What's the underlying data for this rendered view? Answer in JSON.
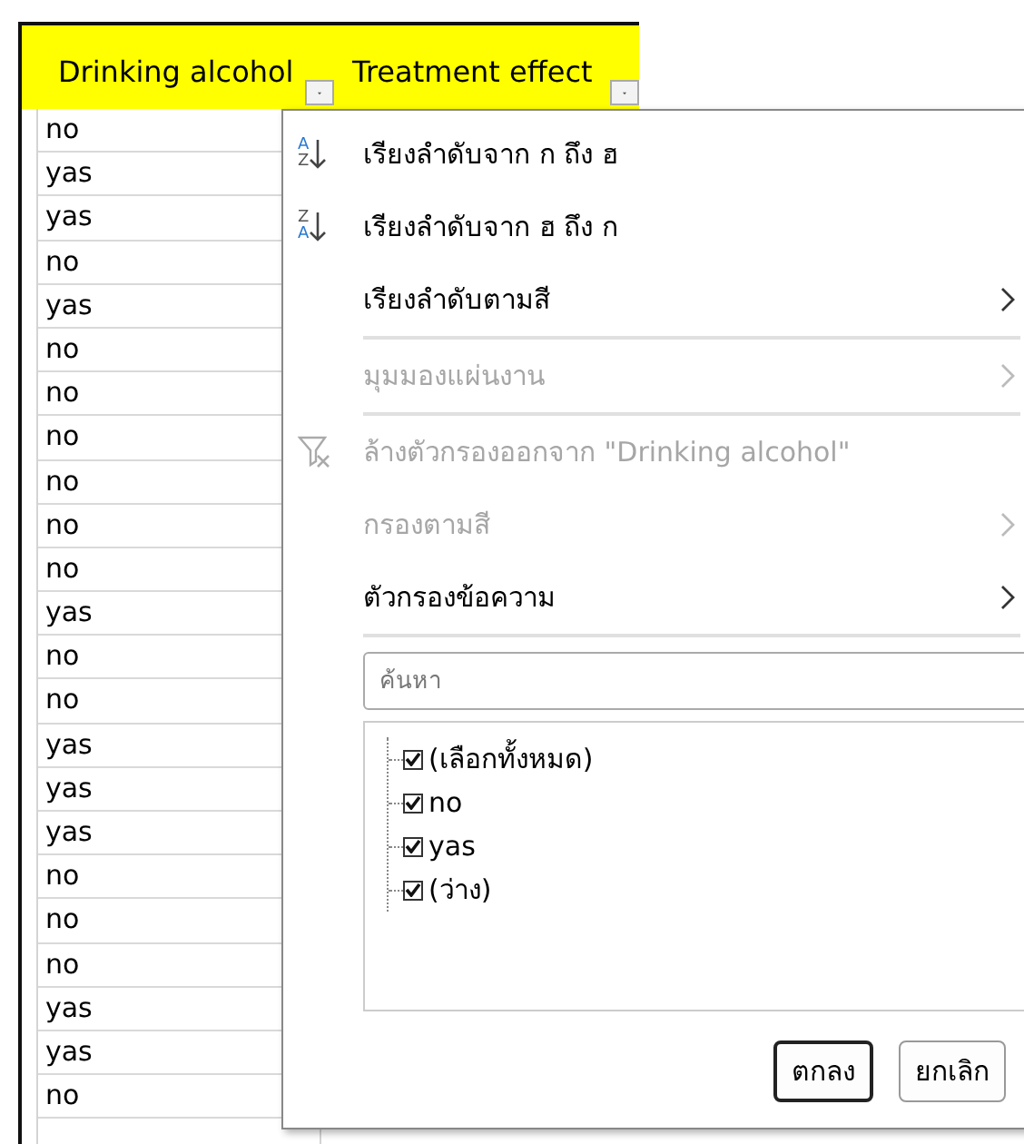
{
  "sheet": {
    "columns": [
      {
        "header": "Drinking alcohol"
      },
      {
        "header": "Treatment effect"
      }
    ],
    "column_b_values": [
      "no",
      "yas",
      "yas",
      "no",
      "yas",
      "no",
      "no",
      "no",
      "no",
      "no",
      "no",
      "yas",
      "no",
      "no",
      "yas",
      "yas",
      "yas",
      "no",
      "no",
      "no",
      "yas",
      "yas",
      "no"
    ]
  },
  "filter_menu": {
    "items": [
      {
        "kind": "sort",
        "icon_letters": [
          "A",
          "Z"
        ],
        "label": "เรียงลำดับจาก ก ถึง ฮ",
        "disabled": false,
        "submenu": false
      },
      {
        "kind": "sort",
        "icon_letters": [
          "Z",
          "A"
        ],
        "label": "เรียงลำดับจาก ฮ ถึง ก",
        "disabled": false,
        "submenu": false
      },
      {
        "kind": "item",
        "label": "เรียงลำดับตามสี",
        "disabled": false,
        "submenu": true
      },
      {
        "kind": "separator"
      },
      {
        "kind": "item",
        "label": "มุมมองแผ่นงาน",
        "disabled": true,
        "submenu": true
      },
      {
        "kind": "separator"
      },
      {
        "kind": "clear",
        "label": "ล้างตัวกรองออกจาก \"Drinking alcohol\"",
        "disabled": true,
        "submenu": false
      },
      {
        "kind": "item",
        "label": "กรองตามสี",
        "disabled": true,
        "submenu": true
      },
      {
        "kind": "item",
        "label": "ตัวกรองข้อความ",
        "disabled": false,
        "submenu": true
      },
      {
        "kind": "separator"
      }
    ],
    "search": {
      "placeholder": "ค้นหา"
    },
    "values": [
      {
        "label": "(เลือกทั้งหมด)",
        "checked": true
      },
      {
        "label": "no",
        "checked": true
      },
      {
        "label": "yas",
        "checked": true
      },
      {
        "label": "(ว่าง)",
        "checked": true
      }
    ],
    "buttons": [
      {
        "label": "ตกลง",
        "default": true
      },
      {
        "label": "ยกเลิก",
        "default": false
      }
    ]
  }
}
